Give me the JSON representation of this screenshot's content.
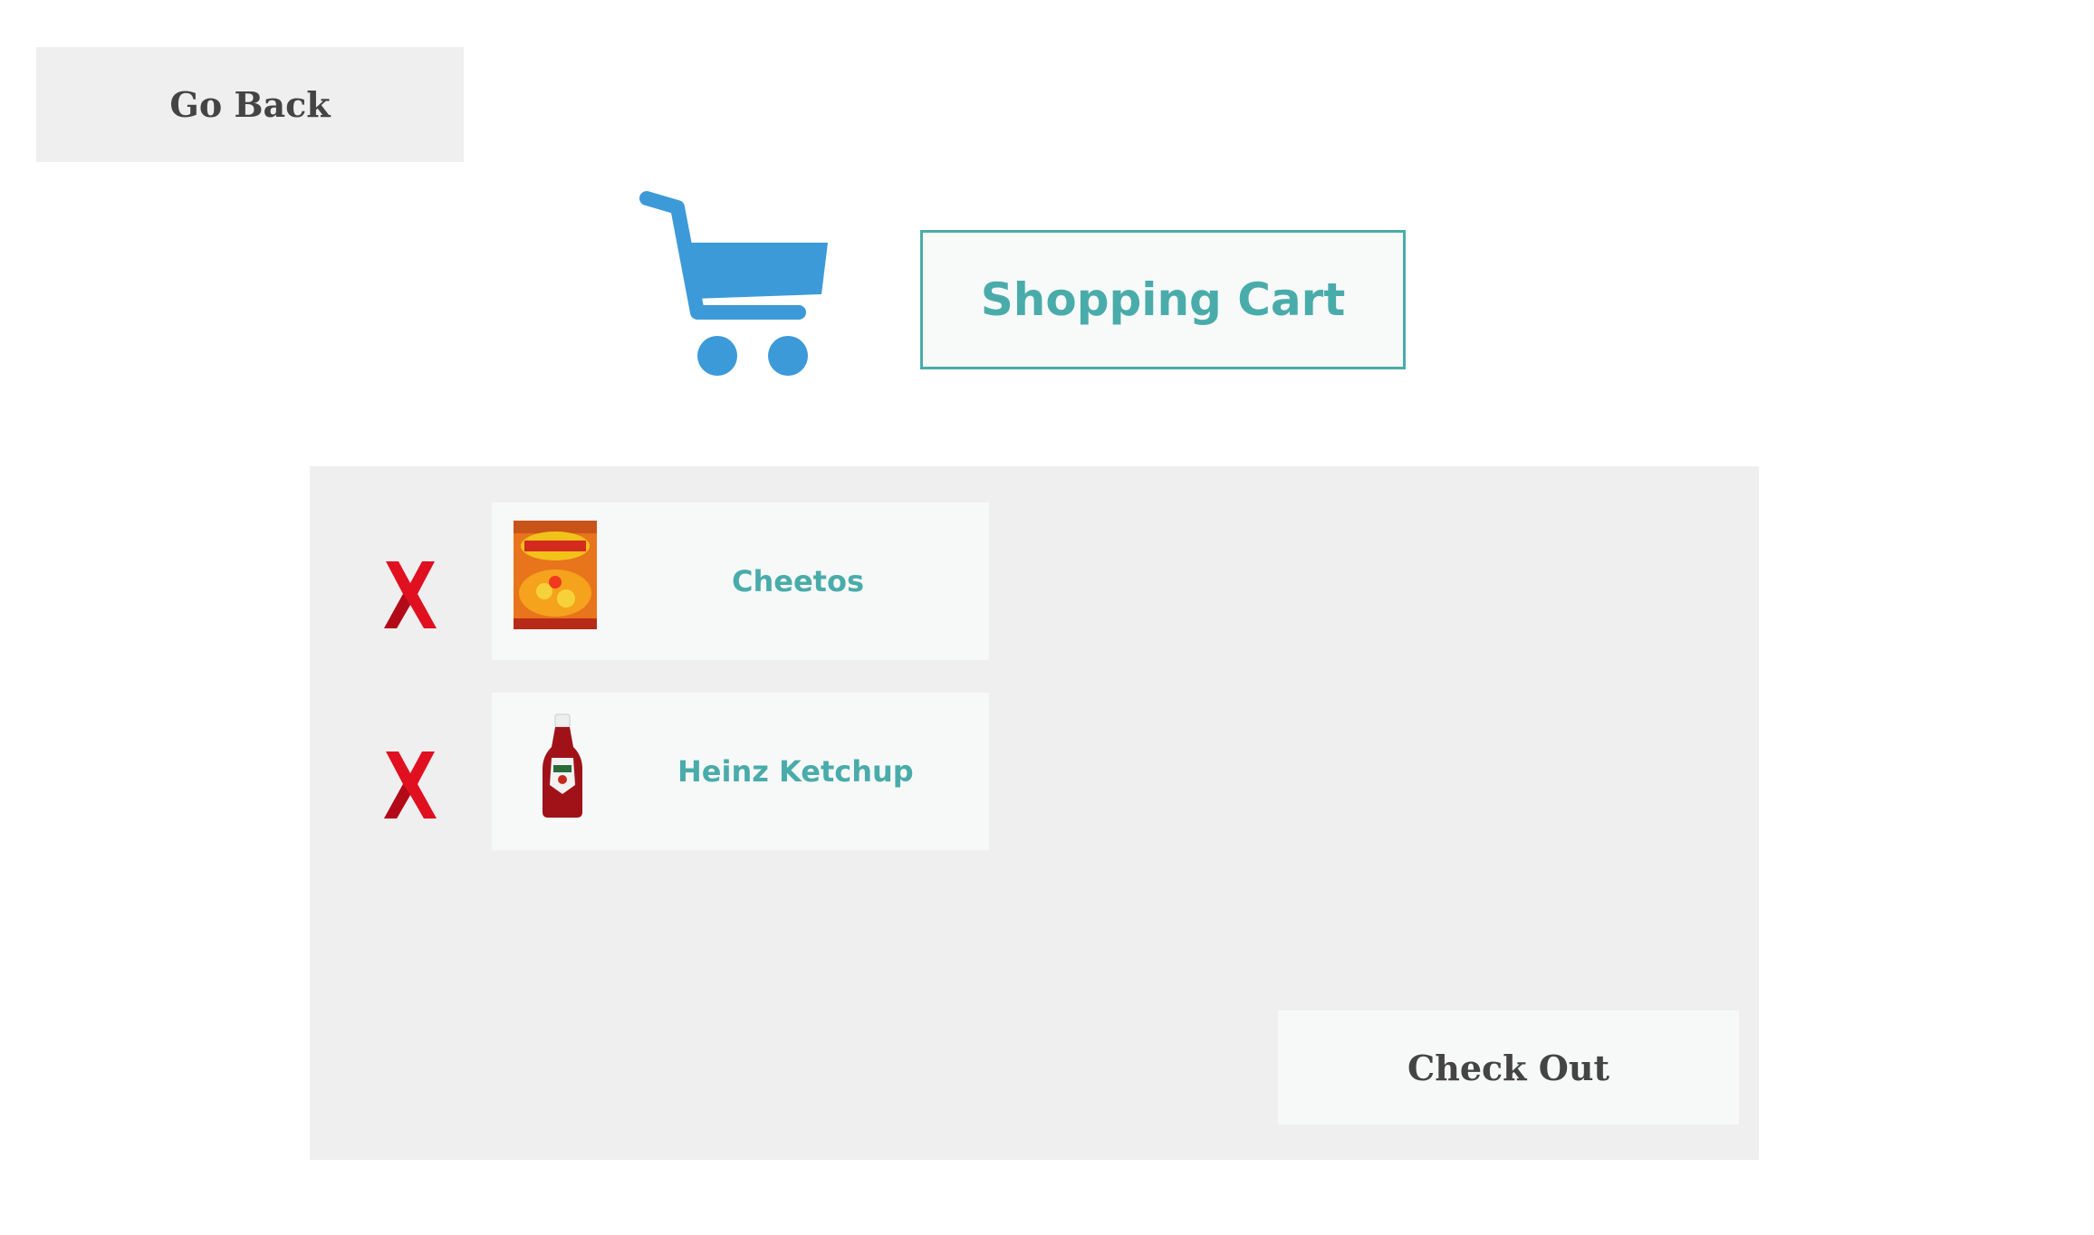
{
  "nav": {
    "back_label": "Go Back"
  },
  "header": {
    "title": "Shopping Cart",
    "icon": "shopping-cart-icon",
    "icon_color": "#3d9ad9"
  },
  "cart": {
    "items": [
      {
        "name": "Cheetos",
        "thumbnail": "cheetos-bag-image"
      },
      {
        "name": "Heinz Ketchup",
        "thumbnail": "ketchup-bottle-image"
      }
    ],
    "remove_icon": "remove-x-icon",
    "checkout_label": "Check Out"
  },
  "colors": {
    "accent": "#4aacaa",
    "panel": "#efefef",
    "card": "#f7f9f8",
    "remove": "#e01020",
    "button_text": "#444444"
  }
}
